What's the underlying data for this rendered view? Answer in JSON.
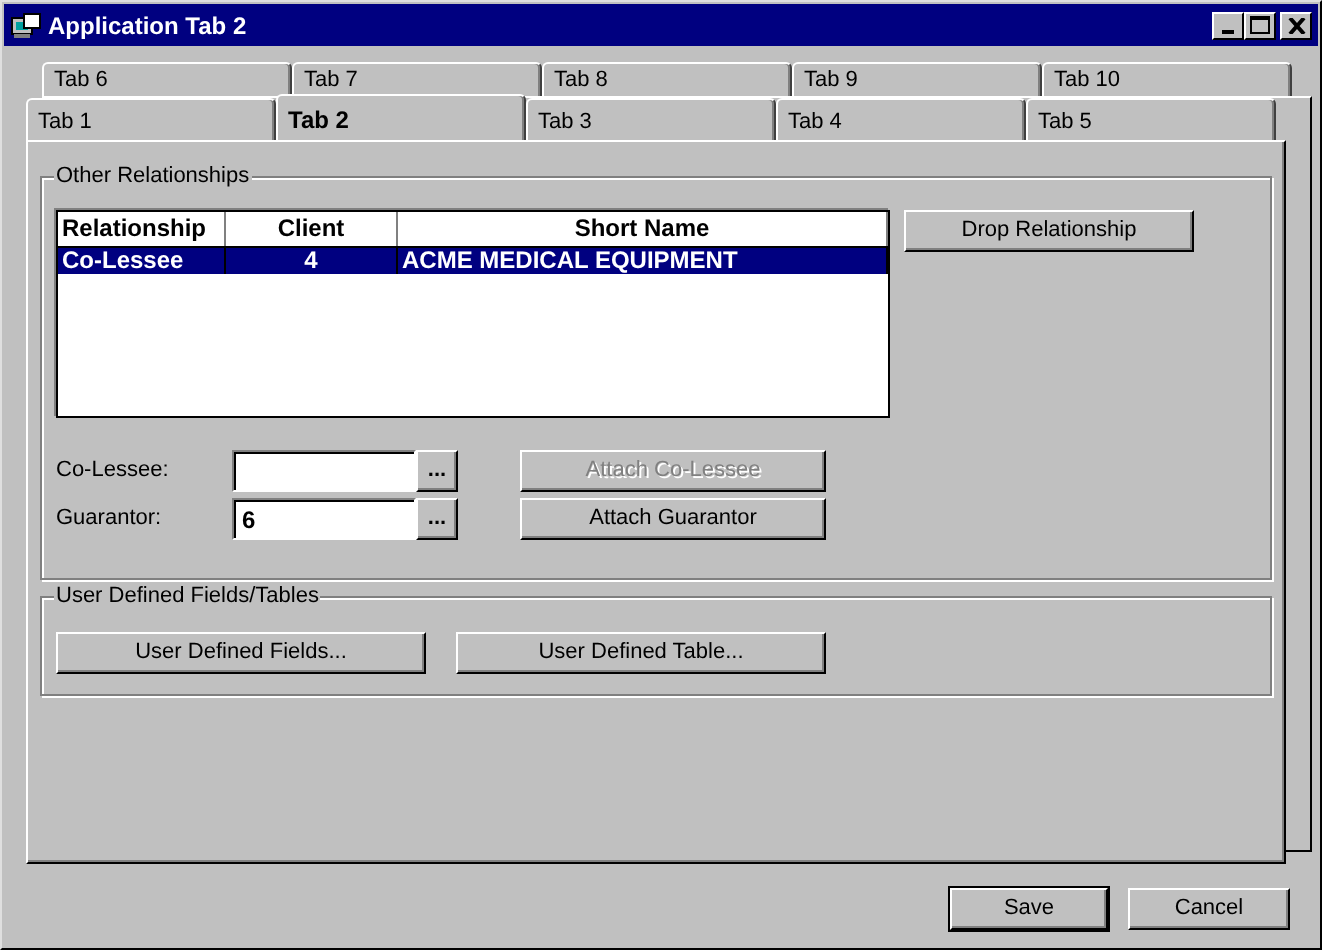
{
  "window": {
    "title": "Application Tab 2"
  },
  "tab_rows": [
    {
      "tabs": [
        {
          "label": "Tab 6",
          "selected": false
        },
        {
          "label": "Tab 7",
          "selected": false
        },
        {
          "label": "Tab 8",
          "selected": false
        },
        {
          "label": "Tab 9",
          "selected": false
        },
        {
          "label": "Tab 10",
          "selected": false
        }
      ]
    },
    {
      "tabs": [
        {
          "label": "Tab 1",
          "selected": false
        },
        {
          "label": "Tab 2",
          "selected": true
        },
        {
          "label": "Tab 3",
          "selected": false
        },
        {
          "label": "Tab 4",
          "selected": false
        },
        {
          "label": "Tab 5",
          "selected": false
        }
      ]
    }
  ],
  "other_relationships": {
    "title": "Other Relationships",
    "table": {
      "columns": [
        "Relationship",
        "Client",
        "Short Name"
      ],
      "rows": [
        {
          "cells": [
            "Co-Lessee",
            "4",
            "ACME MEDICAL EQUIPMENT"
          ],
          "selected": true
        }
      ]
    },
    "drop_button": {
      "label": "Drop Relationship",
      "disabled": false
    },
    "fields": [
      {
        "label": "Co-Lessee:",
        "browse": "...",
        "button": {
          "label": "Attach Co-Lessee",
          "disabled": true
        }
      },
      {
        "label": "Guarantor:",
        "value": "6",
        "browse": "...",
        "button": {
          "label": "Attach Guarantor",
          "disabled": false
        }
      }
    ]
  },
  "user_defined": {
    "title": "User Defined Fields/Tables",
    "buttons": [
      {
        "label": "User Defined Fields...",
        "disabled": false
      },
      {
        "label": "User Defined Table...",
        "disabled": false
      }
    ]
  },
  "footer_buttons": [
    {
      "label": "Save",
      "default": true
    },
    {
      "label": "Cancel",
      "default": false
    }
  ]
}
